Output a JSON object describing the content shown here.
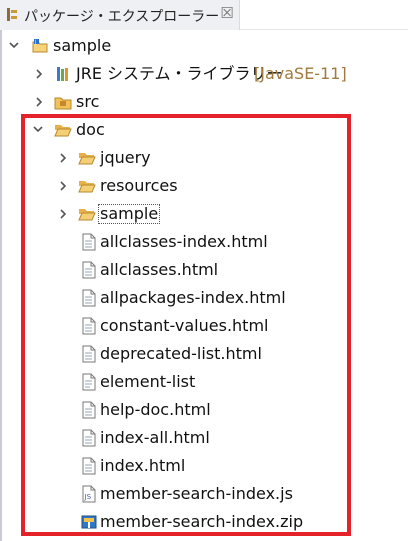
{
  "view": {
    "title": "パッケージ・エクスプローラー",
    "close_glyph": "☒"
  },
  "tree": {
    "project": "sample",
    "jre_label": "JRE システム・ライブラリー",
    "jre_version": "[JavaSE-11]",
    "src": "src",
    "doc": "doc",
    "folders": [
      "jquery",
      "resources",
      "sample"
    ],
    "files": [
      "allclasses-index.html",
      "allclasses.html",
      "allpackages-index.html",
      "constant-values.html",
      "deprecated-list.html",
      "element-list",
      "help-doc.html",
      "index-all.html",
      "index.html",
      "member-search-index.js",
      "member-search-index.zip"
    ]
  },
  "colors": {
    "highlight": "#e4222a",
    "folder": "#e8b04a",
    "jre_version_text": "#a07a3c"
  }
}
